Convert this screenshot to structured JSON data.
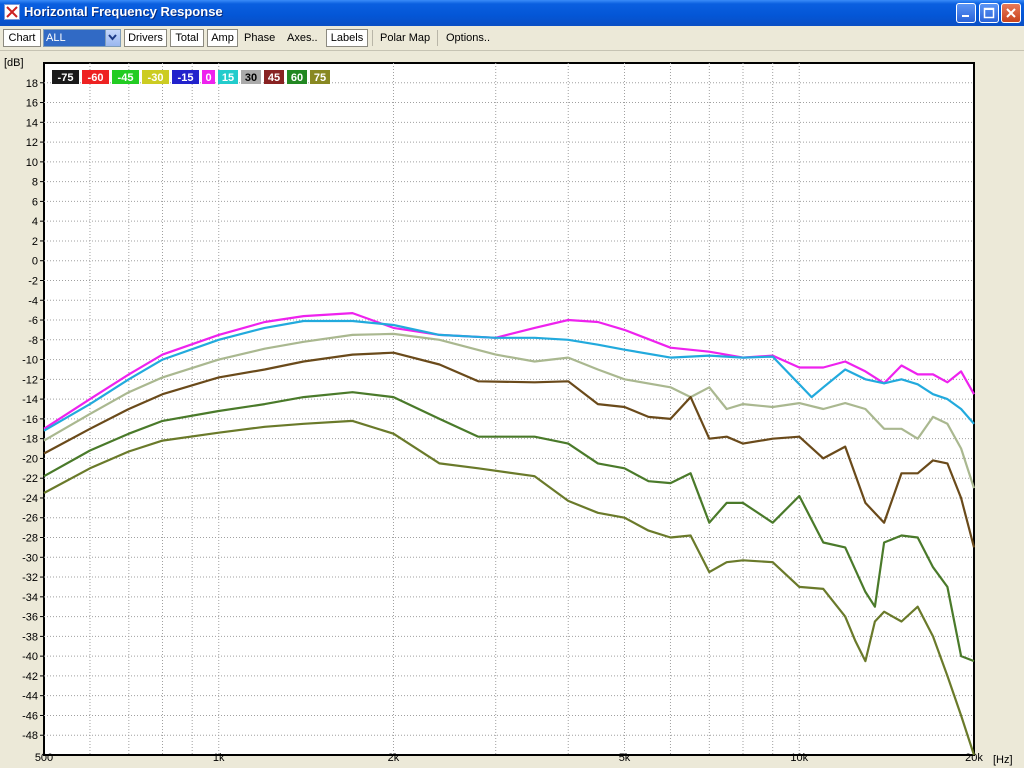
{
  "window": {
    "title": "Horizontal Frequency Response",
    "controls": [
      "minimize-icon",
      "maximize-icon",
      "close-icon"
    ]
  },
  "toolbar": {
    "chart_label": "Chart",
    "chart_select": "ALL",
    "drivers_label": "Drivers",
    "total_label": "Total",
    "amp_label": "Amp",
    "phase_label": "Phase",
    "axes_label": "Axes..",
    "labels_label": "Labels",
    "polar_map_label": "Polar Map",
    "options_label": "Options.."
  },
  "chart_data": {
    "type": "line",
    "ylabel": "[dB]",
    "xlabel": "[Hz]",
    "xscale": "log",
    "xlim": [
      500,
      20000
    ],
    "ylim": [
      -50,
      20
    ],
    "grid": true,
    "legend_position": "top-left",
    "x_tick_labels": [
      {
        "value": 500,
        "label": "500"
      },
      {
        "value": 1000,
        "label": "1k"
      },
      {
        "value": 2000,
        "label": "2k"
      },
      {
        "value": 5000,
        "label": "5k"
      },
      {
        "value": 10000,
        "label": "10k"
      },
      {
        "value": 20000,
        "label": "20k"
      }
    ],
    "y_ticks": [
      18,
      16,
      14,
      12,
      10,
      8,
      6,
      4,
      2,
      0,
      -2,
      -4,
      -6,
      -8,
      -10,
      -12,
      -14,
      -16,
      -18,
      -20,
      -22,
      -24,
      -26,
      -28,
      -30,
      -32,
      -34,
      -36,
      -38,
      -40,
      -42,
      -44,
      -46,
      -48
    ],
    "legend": [
      {
        "label": "-75",
        "bg": "#1a1a1a",
        "fg": "#ffffff"
      },
      {
        "label": "-60",
        "bg": "#ee2222",
        "fg": "#ffffff"
      },
      {
        "label": "-45",
        "bg": "#22cc22",
        "fg": "#ffffff"
      },
      {
        "label": "-30",
        "bg": "#cccc22",
        "fg": "#ffffff"
      },
      {
        "label": "-15",
        "bg": "#2222cc",
        "fg": "#ffffff"
      },
      {
        "label": "0",
        "bg": "#ee22ee",
        "fg": "#ffffff"
      },
      {
        "label": "15",
        "bg": "#22cccc",
        "fg": "#ffffff"
      },
      {
        "label": "30",
        "bg": "#aaaaaa",
        "fg": "#000000"
      },
      {
        "label": "45",
        "bg": "#882222",
        "fg": "#ffffff"
      },
      {
        "label": "60",
        "bg": "#228822",
        "fg": "#ffffff"
      },
      {
        "label": "75",
        "bg": "#888822",
        "fg": "#ffffff"
      }
    ],
    "series": [
      {
        "name": "0",
        "color": "#ee22ee",
        "x": [
          500,
          600,
          700,
          800,
          1000,
          1200,
          1400,
          1700,
          2000,
          2400,
          3000,
          3500,
          4000,
          4500,
          5000,
          6000,
          7000,
          8000,
          9000,
          10000,
          11000,
          12000,
          13000,
          14000,
          15000,
          16000,
          17000,
          18000,
          19000,
          20000
        ],
        "y": [
          -17,
          -14,
          -11.5,
          -9.5,
          -7.5,
          -6.2,
          -5.6,
          -5.3,
          -6.8,
          -7.5,
          -7.8,
          -6.8,
          -6.0,
          -6.2,
          -7.0,
          -8.8,
          -9.2,
          -9.8,
          -9.6,
          -10.8,
          -10.8,
          -10.2,
          -11.2,
          -12.4,
          -10.6,
          -11.5,
          -11.5,
          -12.3,
          -11.2,
          -13.5
        ]
      },
      {
        "name": "15",
        "color": "#22aadd",
        "x": [
          500,
          600,
          700,
          800,
          1000,
          1200,
          1400,
          1700,
          2000,
          2400,
          3000,
          3500,
          4000,
          4500,
          5000,
          6000,
          7000,
          8000,
          9000,
          10000,
          10500,
          11000,
          12000,
          13000,
          14000,
          15000,
          16000,
          17000,
          18000,
          19000,
          20000
        ],
        "y": [
          -17.2,
          -14.5,
          -12,
          -10,
          -8,
          -6.8,
          -6.1,
          -6.1,
          -6.5,
          -7.5,
          -7.8,
          -7.8,
          -8.0,
          -8.5,
          -9.0,
          -9.8,
          -9.6,
          -9.8,
          -9.7,
          -12.5,
          -13.8,
          -12.8,
          -11.0,
          -12.0,
          -12.4,
          -12.0,
          -12.5,
          -13.5,
          -14.0,
          -15.0,
          -16.5
        ]
      },
      {
        "name": "30",
        "color": "#aab890",
        "x": [
          500,
          600,
          700,
          800,
          1000,
          1200,
          1400,
          1700,
          2000,
          2400,
          3000,
          3500,
          4000,
          4500,
          5000,
          6000,
          6500,
          7000,
          7500,
          8000,
          9000,
          10000,
          11000,
          12000,
          13000,
          14000,
          15000,
          16000,
          17000,
          18000,
          19000,
          20000
        ],
        "y": [
          -18.2,
          -15.5,
          -13.3,
          -11.8,
          -10.0,
          -8.9,
          -8.2,
          -7.5,
          -7.4,
          -8.0,
          -9.5,
          -10.2,
          -9.8,
          -11.0,
          -12.0,
          -12.8,
          -13.8,
          -12.8,
          -15.0,
          -14.5,
          -14.8,
          -14.4,
          -15.0,
          -14.4,
          -15.0,
          -17.0,
          -17.0,
          -18.0,
          -15.8,
          -16.5,
          -19.0,
          -23.0
        ]
      },
      {
        "name": "45",
        "color": "#6a4a1a",
        "x": [
          500,
          600,
          700,
          800,
          1000,
          1200,
          1400,
          1700,
          2000,
          2400,
          2800,
          3500,
          4000,
          4500,
          5000,
          5500,
          6000,
          6500,
          7000,
          7500,
          8000,
          9000,
          10000,
          11000,
          12000,
          13000,
          14000,
          15000,
          16000,
          17000,
          18000,
          19000,
          20000
        ],
        "y": [
          -19.5,
          -17.0,
          -15.0,
          -13.5,
          -11.8,
          -11.0,
          -10.2,
          -9.5,
          -9.3,
          -10.5,
          -12.2,
          -12.3,
          -12.2,
          -14.5,
          -14.8,
          -15.8,
          -16.0,
          -13.8,
          -18.0,
          -17.8,
          -18.5,
          -18.0,
          -17.8,
          -20.0,
          -18.8,
          -24.5,
          -26.5,
          -21.5,
          -21.5,
          -20.2,
          -20.5,
          -24.0,
          -29.0
        ]
      },
      {
        "name": "60",
        "color": "#4a7a2a",
        "x": [
          500,
          600,
          700,
          800,
          1000,
          1200,
          1400,
          1700,
          2000,
          2400,
          2800,
          3500,
          4000,
          4500,
          5000,
          5500,
          6000,
          6500,
          7000,
          7500,
          8000,
          9000,
          10000,
          11000,
          12000,
          13000,
          13500,
          14000,
          15000,
          16000,
          17000,
          18000,
          19000,
          20000
        ],
        "y": [
          -21.8,
          -19.2,
          -17.5,
          -16.2,
          -15.2,
          -14.5,
          -13.8,
          -13.3,
          -13.8,
          -16.0,
          -17.8,
          -17.8,
          -18.5,
          -20.5,
          -21.0,
          -22.3,
          -22.5,
          -21.5,
          -26.5,
          -24.5,
          -24.5,
          -26.5,
          -23.8,
          -28.5,
          -29.0,
          -33.5,
          -35.0,
          -28.5,
          -27.8,
          -28.0,
          -31.0,
          -33.0,
          -40.0,
          -40.5
        ]
      },
      {
        "name": "75",
        "color": "#6a7a2a",
        "x": [
          500,
          600,
          700,
          800,
          1000,
          1200,
          1400,
          1700,
          2000,
          2400,
          2800,
          3500,
          4000,
          4500,
          5000,
          5500,
          6000,
          6500,
          7000,
          7500,
          8000,
          9000,
          10000,
          11000,
          12000,
          12500,
          13000,
          13500,
          14000,
          15000,
          16000,
          17000,
          18000,
          19000,
          20000
        ],
        "y": [
          -23.5,
          -21.0,
          -19.3,
          -18.2,
          -17.4,
          -16.8,
          -16.5,
          -16.2,
          -17.5,
          -20.5,
          -21.0,
          -21.8,
          -24.3,
          -25.5,
          -26.0,
          -27.3,
          -28.0,
          -27.8,
          -31.5,
          -30.5,
          -30.3,
          -30.5,
          -33.0,
          -33.2,
          -36.0,
          -38.5,
          -40.5,
          -36.5,
          -35.5,
          -36.5,
          -35.0,
          -38.0,
          -42.0,
          -46.0,
          -50.0
        ]
      }
    ]
  }
}
